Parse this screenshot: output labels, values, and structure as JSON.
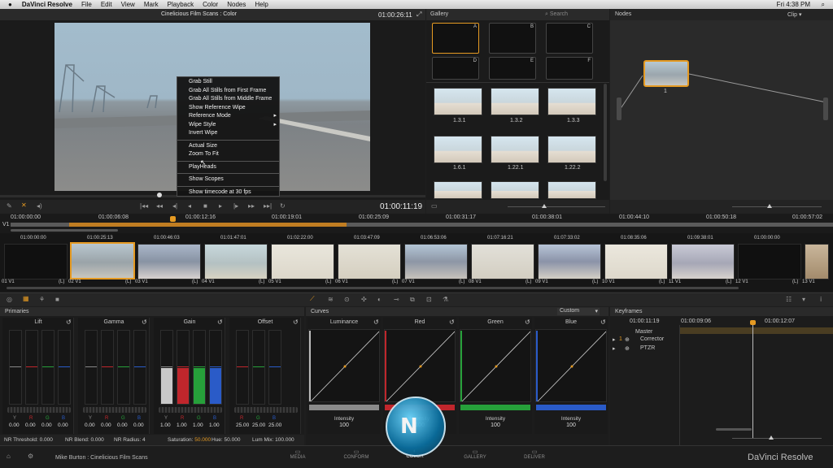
{
  "menubar": {
    "app": "DaVinci Resolve",
    "items": [
      "File",
      "Edit",
      "View",
      "Mark",
      "Playback",
      "Color",
      "Nodes",
      "Help"
    ],
    "clock": "Fri 4:38 PM"
  },
  "viewer": {
    "title": "Cinelicious Film Scans : Color",
    "timecode": "01:00:26:11",
    "playhead": "01:00:11:19"
  },
  "context_menu": [
    "Grab Still",
    "Grab All Stills from First Frame",
    "Grab All Stills from Middle Frame",
    "Show Reference Wipe",
    "Reference Mode",
    "Wipe Style",
    "Invert Wipe",
    "Actual Size",
    "Zoom To Fit",
    "PlayHeads",
    "Show Scopes",
    "Show timecode at 30 fps"
  ],
  "gallery": {
    "title": "Gallery",
    "search": "Search",
    "slots": [
      "A",
      "B",
      "C",
      "D",
      "E",
      "F"
    ],
    "stills": [
      "1.3.1",
      "1.3.2",
      "1.3.3",
      "1.6.1",
      "1.22.1",
      "1.22.2"
    ]
  },
  "nodes": {
    "title": "Nodes",
    "mode": "Clip",
    "node_label": "1"
  },
  "timeline": {
    "track": "V1",
    "ruler": [
      "01:00:00:00",
      "01:00:06:08",
      "01:00:12:16",
      "01:00:19:01",
      "01:00:25:09",
      "01:00:31:17",
      "01:00:38:01",
      "01:00:44:10",
      "01:00:50:18",
      "01:00:57:02"
    ]
  },
  "clips": [
    {
      "tc": "01:00:00:00",
      "label": "01 V1"
    },
    {
      "tc": "01:00:25:13",
      "label": "02 V1"
    },
    {
      "tc": "01:00:46:03",
      "label": "03 V1"
    },
    {
      "tc": "01:01:47:01",
      "label": "04 V1"
    },
    {
      "tc": "01:02:22:00",
      "label": "05 V1"
    },
    {
      "tc": "01:03:47:09",
      "label": "06 V1"
    },
    {
      "tc": "01:06:53:06",
      "label": "07 V1"
    },
    {
      "tc": "01:07:16:21",
      "label": "08 V1"
    },
    {
      "tc": "01:07:33:02",
      "label": "09 V1"
    },
    {
      "tc": "01:08:35:06",
      "label": "10 V1"
    },
    {
      "tc": "01:09:38:01",
      "label": "11 V1"
    },
    {
      "tc": "01:00:00:00",
      "label": "12 V1"
    },
    {
      "tc": "",
      "label": "13 V1"
    }
  ],
  "clip_flag": "(L)",
  "primaries": {
    "title": "Primaries",
    "wheels": [
      {
        "name": "Lift",
        "vals": [
          "0.00",
          "0.00",
          "0.00",
          "0.00"
        ]
      },
      {
        "name": "Gamma",
        "vals": [
          "0.00",
          "0.00",
          "0.00",
          "0.00"
        ]
      },
      {
        "name": "Gain",
        "vals": [
          "1.00",
          "1.00",
          "1.00",
          "1.00"
        ]
      },
      {
        "name": "Offset",
        "vals": [
          "25.00",
          "25.00",
          "25.00"
        ]
      }
    ],
    "chan": [
      "Y",
      "R",
      "G",
      "B"
    ],
    "footer": [
      {
        "l": "NR Threshold:",
        "v": "0.000"
      },
      {
        "l": "NR Blend:",
        "v": "0.000"
      },
      {
        "l": "NR Radius:",
        "v": "4"
      },
      {
        "l": "Saturation:",
        "v": "50.000"
      },
      {
        "l": "Hue:",
        "v": "50.000"
      },
      {
        "l": "Lum Mix:",
        "v": "100.000"
      }
    ]
  },
  "curves": {
    "title": "Curves",
    "mode": "Custom",
    "channels": [
      {
        "name": "Luminance",
        "intensity": "100"
      },
      {
        "name": "Red",
        "intensity": "100"
      },
      {
        "name": "Green",
        "intensity": "100"
      },
      {
        "name": "Blue",
        "intensity": "100"
      }
    ],
    "intensity_label": "Intensity"
  },
  "keyframes": {
    "title": "Keyframes",
    "tc1": "01:00:11:19",
    "tc2": "01:00:09:06",
    "tc3": "01:00:12:07",
    "master": "Master",
    "rows": [
      "Corrector",
      "PTZR"
    ]
  },
  "bottom": {
    "user": "Mike Burton : Cinelicious Film Scans",
    "tabs": [
      "MEDIA",
      "CONFORM",
      "COLOR",
      "GALLERY",
      "DELIVER"
    ],
    "brand": "DaVinci Resolve"
  },
  "colors": {
    "accent": "#e59a22",
    "red": "#c0262c",
    "green": "#26a03a",
    "blue": "#2a5bc8"
  }
}
